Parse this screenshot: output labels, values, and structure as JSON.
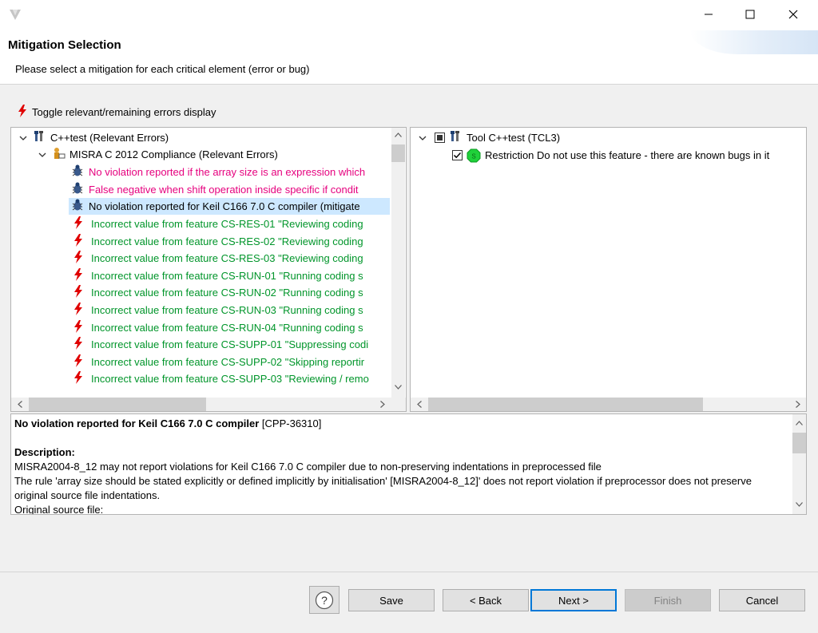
{
  "header": {
    "title": "Mitigation Selection",
    "subtitle": "Please select a mitigation for each critical element (error or bug)"
  },
  "toggle": {
    "label": "Toggle relevant/remaining errors display"
  },
  "left_tree": {
    "root": {
      "label": "C++test (Relevant Errors)",
      "icon": "tool-icon"
    },
    "group": {
      "label": "MISRA C 2012 Compliance (Relevant Errors)",
      "icon": "user-folder-icon"
    },
    "bugs": [
      {
        "label": "No violation reported if the array size is an expression which",
        "color": "#e6007e"
      },
      {
        "label": "False negative when shift operation inside specific if condit",
        "color": "#e6007e"
      },
      {
        "label": "No violation reported for Keil C166 7.0 C compiler (mitigate",
        "color": "#000000",
        "selected": true
      }
    ],
    "errors": [
      "Incorrect value from feature CS-RES-01 \"Reviewing coding",
      "Incorrect value from feature CS-RES-02 \"Reviewing coding",
      "Incorrect value from feature CS-RES-03 \"Reviewing coding",
      "Incorrect value from feature CS-RUN-01 \"Running coding s",
      "Incorrect value from feature CS-RUN-02 \"Running coding s",
      "Incorrect value from feature CS-RUN-03 \"Running coding s",
      "Incorrect value from feature CS-RUN-04 \"Running coding s",
      "Incorrect value from feature CS-SUPP-01 \"Suppressing codi",
      "Incorrect value from feature CS-SUPP-02 \"Skipping reportir",
      "Incorrect value from feature CS-SUPP-03 \"Reviewing / remo"
    ]
  },
  "right_tree": {
    "root": {
      "label": "Tool C++test (TCL3)",
      "icon": "tool-icon"
    },
    "child": {
      "label": "Restriction Do not use this feature - there are known bugs in it",
      "icon": "restriction-icon",
      "checked": true
    }
  },
  "description": {
    "title": "No violation reported for Keil C166 7.0 C compiler",
    "id": "[CPP-36310]",
    "heading": "Description:",
    "line1": "MISRA2004-8_12 may not report violations for Keil C166 7.0 C compiler due to non-preserving indentations in preprocessed file",
    "line2": "The rule 'array size should be stated explicitly or defined implicitly by initialisation' [MISRA2004-8_12]' does not report violation if preprocessor does not preserve original source file indentations.",
    "line3": "Original source file:"
  },
  "buttons": {
    "help": "?",
    "save": "Save",
    "back": "< Back",
    "next": "Next >",
    "finish": "Finish",
    "cancel": "Cancel"
  },
  "colors": {
    "pink": "#e6007e",
    "green": "#00952a",
    "accent": "#0078d7",
    "selection": "#cde8ff"
  }
}
